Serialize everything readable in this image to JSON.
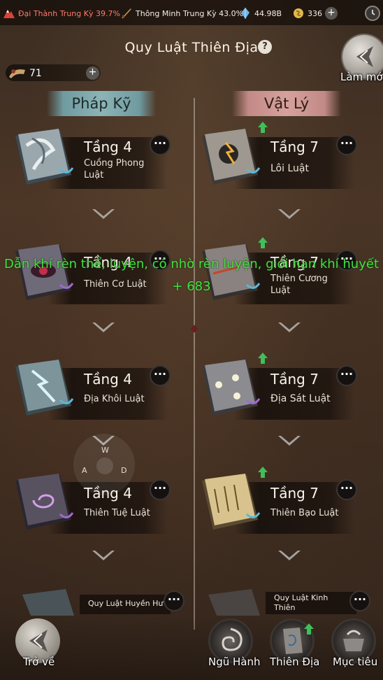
{
  "topbar": {
    "stat1": "Đại Thành Trung Kỳ 39.7%",
    "stat2": "Thông Minh Trung Kỳ 43.0%",
    "stat3": "44.98B",
    "stat4": "336"
  },
  "header": {
    "title": "Quy Luật Thiên Địa",
    "help": "?",
    "refresh_label": "Làm mới"
  },
  "resource": {
    "count": "71",
    "plus": "+"
  },
  "columns": {
    "left": "Pháp Kỹ",
    "right": "Vật Lý"
  },
  "left_cards": [
    {
      "tier": "Tầng 4",
      "name": "Cuồng Phong Luật"
    },
    {
      "tier": "Tầng 4",
      "name": "Thiên Cơ Luật"
    },
    {
      "tier": "Tầng 4",
      "name": "Địa Khôi Luật"
    },
    {
      "tier": "Tầng 4",
      "name": "Thiên Tuệ Luật"
    }
  ],
  "right_cards": [
    {
      "tier": "Tầng 7",
      "name": "Lôi Luật"
    },
    {
      "tier": "Tầng 7",
      "name": "Thiên Cương Luật"
    },
    {
      "tier": "Tầng 7",
      "name": "Địa Sát Luật"
    },
    {
      "tier": "Tầng 7",
      "name": "Thiên Bạo Luật"
    }
  ],
  "bottom_cards": {
    "left": "Quy Luật Huyền Hư",
    "right": "Quy Luật Kinh Thiên"
  },
  "more_glyph": "···",
  "floating_text": {
    "line1": "Dẫn khí rèn thể, luyện, có nhờ rèn luyện, giới hạn khí huyết",
    "line2": "+ 683"
  },
  "joystick": {
    "w": "W",
    "a": "A",
    "d": "D"
  },
  "nav": {
    "back": "Trở về",
    "ngu_hanh": "Ngũ Hành",
    "thien_dia": "Thiên Địa",
    "muc_tieu": "Mục tiêu"
  },
  "colors": {
    "left_header": "#8cb4b6",
    "right_header": "#d6a19c",
    "floating_text": "#43e03e",
    "stat_red": "#ff7a6a"
  }
}
